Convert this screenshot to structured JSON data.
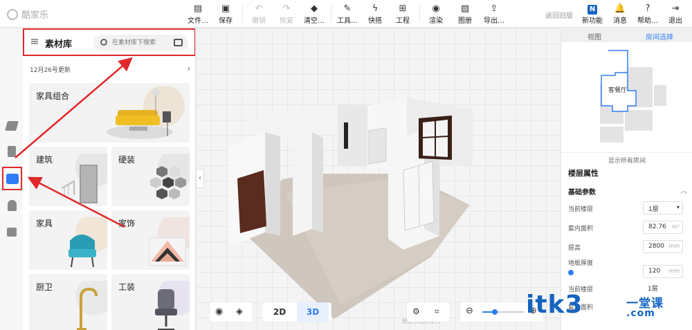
{
  "app": {
    "logo_text": "酷家乐"
  },
  "toolbar": {
    "file": "文件",
    "save": "保存",
    "undo": "撤销",
    "redo": "恢复",
    "clear": "清空",
    "tools": "工具",
    "quick_draw": "快搭",
    "engineering": "工程",
    "render": "渲染",
    "album": "图册",
    "export": "导出",
    "back_old": "返回旧版",
    "new_features": "新功能",
    "new_badge": "N",
    "messages": "消息",
    "help": "帮助",
    "logout": "退出"
  },
  "material_panel": {
    "title": "素材库",
    "search_placeholder": "在素材库下搜索",
    "update_text": "12月26号更新",
    "cards": [
      {
        "label": "家具组合"
      },
      {
        "label": "建筑"
      },
      {
        "label": "硬装"
      },
      {
        "label": "家具"
      },
      {
        "label": "家饰"
      },
      {
        "label": "厨卫"
      },
      {
        "label": "工装"
      }
    ]
  },
  "canvas": {
    "collapse_glyph": "‹",
    "watermark": "酷家乐技术支持"
  },
  "view_controls": {
    "btn_2d": "2D",
    "btn_3d": "3D",
    "active": "3D",
    "zoom_level": 0.3
  },
  "right_panel": {
    "tabs": [
      "视图",
      "房间选择"
    ],
    "active_tab": "房间选择",
    "room_label": "客餐厅",
    "show_all": "显示所有房间",
    "floor_props_title": "楼层属性",
    "basic_params": "基础参数",
    "props": [
      {
        "label": "当前楼层",
        "value": "1层",
        "unit": "▾"
      },
      {
        "label": "套内面积",
        "value": "82.76",
        "unit": "m²"
      },
      {
        "label": "层高",
        "value": "2800",
        "unit": "mm"
      },
      {
        "label": "地板厚度",
        "value": "120",
        "unit": "mm"
      },
      {
        "label": "当前楼层",
        "value": "1层",
        "unit": ""
      },
      {
        "label": "套内面积",
        "value": "",
        "unit": ""
      }
    ]
  },
  "site_watermark": {
    "main": "itk3",
    "cn": "一堂课",
    "domain": ".com"
  },
  "colors": {
    "accent": "#2e7df6",
    "highlight": "#e0282a",
    "watermark": "#1565c0"
  }
}
